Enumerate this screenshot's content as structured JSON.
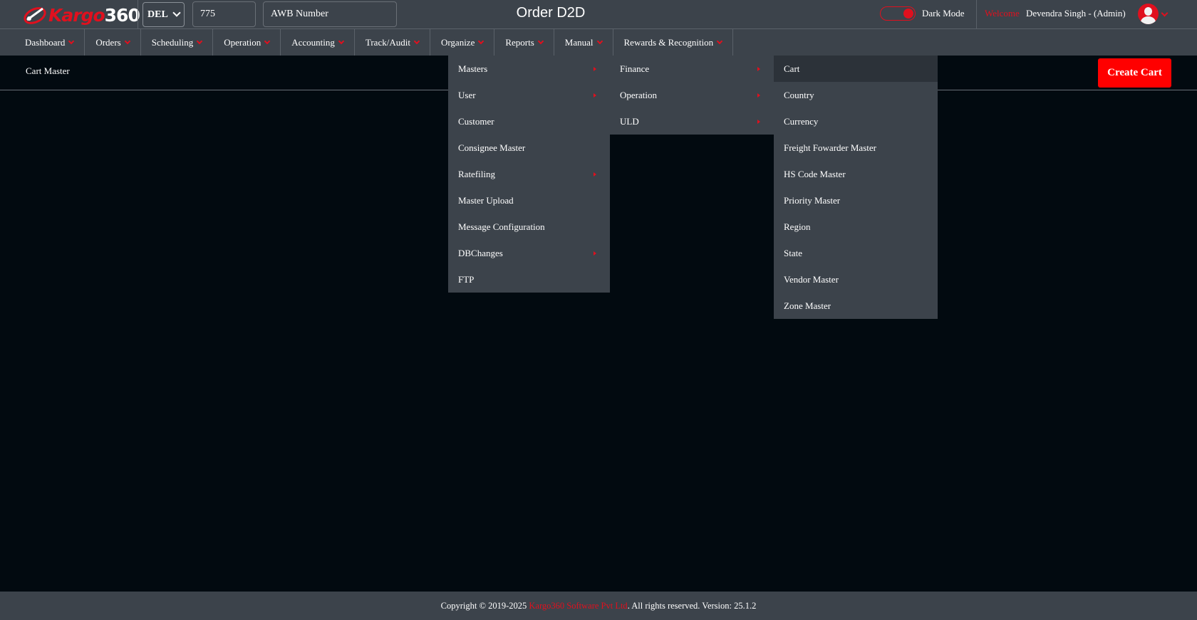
{
  "header": {
    "logo": {
      "part1": "Kargo",
      "part2": "360"
    },
    "station": "DEL",
    "prefix_value": "775",
    "awb_placeholder": "AWB Number",
    "title": "Order D2D",
    "dark_mode_label": "Dark Mode",
    "dark_mode_on": true,
    "welcome": "Welcome",
    "user": "Devendra Singh - (Admin)"
  },
  "nav": [
    {
      "label": "Dashboard"
    },
    {
      "label": "Orders"
    },
    {
      "label": "Scheduling"
    },
    {
      "label": "Operation"
    },
    {
      "label": "Accounting"
    },
    {
      "label": "Track/Audit"
    },
    {
      "label": "Organize"
    },
    {
      "label": "Reports"
    },
    {
      "label": "Manual"
    },
    {
      "label": "Rewards & Recognition"
    }
  ],
  "page": {
    "breadcrumb": "Cart Master",
    "create_button": "Create Cart"
  },
  "organize_menu": [
    {
      "label": "Masters",
      "submenu": true
    },
    {
      "label": "User",
      "submenu": true
    },
    {
      "label": "Customer",
      "submenu": false
    },
    {
      "label": "Consignee Master",
      "submenu": false
    },
    {
      "label": "Ratefiling",
      "submenu": true
    },
    {
      "label": "Master Upload",
      "submenu": false
    },
    {
      "label": "Message Configuration",
      "submenu": false
    },
    {
      "label": "DBChanges",
      "submenu": true
    },
    {
      "label": "FTP",
      "submenu": false
    }
  ],
  "masters_menu": [
    {
      "label": "Finance",
      "submenu": true
    },
    {
      "label": "Operation",
      "submenu": true
    },
    {
      "label": "ULD",
      "submenu": true
    }
  ],
  "finance_menu": [
    {
      "label": "Cart"
    },
    {
      "label": "Country"
    },
    {
      "label": "Currency"
    },
    {
      "label": "Freight Fowarder Master"
    },
    {
      "label": "HS Code Master"
    },
    {
      "label": "Priority Master"
    },
    {
      "label": "Region"
    },
    {
      "label": "State"
    },
    {
      "label": "Vendor Master"
    },
    {
      "label": "Zone Master"
    }
  ],
  "footer": {
    "prefix": "Copyright © 2019-2025",
    "company": "Kargo360 Software Pvt Ltd",
    "suffix": ". All rights reserved. Version: 25.1.2"
  },
  "colors": {
    "accent": "#e0101e",
    "button": "#ff0000",
    "bar": "#3c434b",
    "background": "#020a10"
  }
}
